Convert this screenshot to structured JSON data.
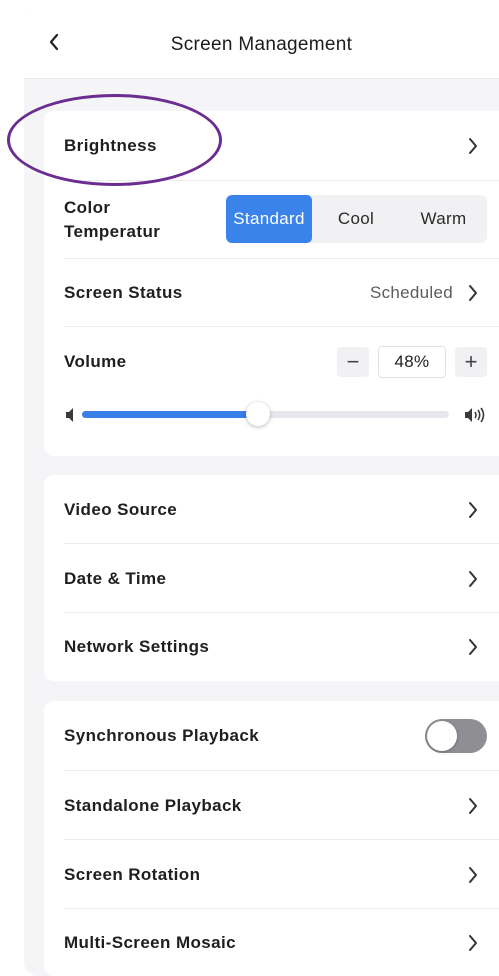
{
  "header": {
    "title": "Screen Management",
    "back_icon": "back-arrow-icon"
  },
  "display_card": {
    "brightness": {
      "label": "Brightness"
    },
    "color_temperature": {
      "label": "Color Temperatur",
      "options": [
        "Standard",
        "Cool",
        "Warm"
      ],
      "selected": "Standard"
    },
    "screen_status": {
      "label": "Screen Status",
      "value": "Scheduled"
    },
    "volume": {
      "label": "Volume",
      "minus": "−",
      "plus": "+",
      "value_text": "48%",
      "level": 0.48,
      "low_icon": "speaker-low-icon",
      "high_icon": "speaker-high-icon"
    }
  },
  "settings_card": {
    "items": [
      {
        "label": "Video Source"
      },
      {
        "label": "Date & Time"
      },
      {
        "label": "Network Settings"
      }
    ]
  },
  "playback_card": {
    "sync": {
      "label": "Synchronous Playback",
      "enabled": false
    },
    "items": [
      {
        "label": "Standalone Playback"
      },
      {
        "label": "Screen Rotation"
      },
      {
        "label": "Multi-Screen Mosaic"
      }
    ]
  },
  "colors": {
    "accent": "#3a83ea",
    "toggle_off": "#8e8e93",
    "annotation_circle": "#6b2d8f",
    "background": "#f5f5f7"
  }
}
